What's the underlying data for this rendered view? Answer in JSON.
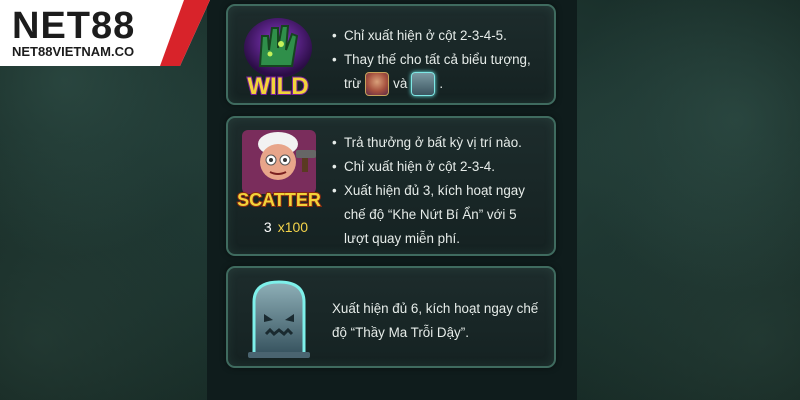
{
  "logo": {
    "brand": "NET88",
    "domain": "NET88VIETNAM.CO",
    "colors": {
      "primary": "#d8232a",
      "dark": "#1c1c1c",
      "bg": "#ffffff"
    }
  },
  "cards": {
    "wild": {
      "symbol_icon": "wild-zombie-hand-icon",
      "symbol_label": "WILD",
      "lines": [
        "Chỉ xuất hiện ở cột 2-3-4-5.",
        "Thay thế cho tất cả biểu tượng,"
      ],
      "line3_prefix": "trừ",
      "line3_middle": "và",
      "line3_suffix": "."
    },
    "scatter": {
      "symbol_icon": "scatter-grandma-icon",
      "symbol_label": "SCATTER",
      "payout_count": "3",
      "payout_multiplier": "x100",
      "lines": [
        "Trả thưởng ở bất kỳ vị trí nào.",
        "Chỉ xuất hiện ở cột 2-3-4.",
        "Xuất hiện đủ 3, kích hoạt ngay chế độ “Khe Nứt Bí Ẩn” với 5 lượt quay miễn phí."
      ]
    },
    "tomb": {
      "symbol_icon": "tombstone-icon",
      "text": "Xuất hiện đủ 6, kích hoạt ngay chế độ “Thầy Ma Trỗi Dậy”."
    }
  }
}
